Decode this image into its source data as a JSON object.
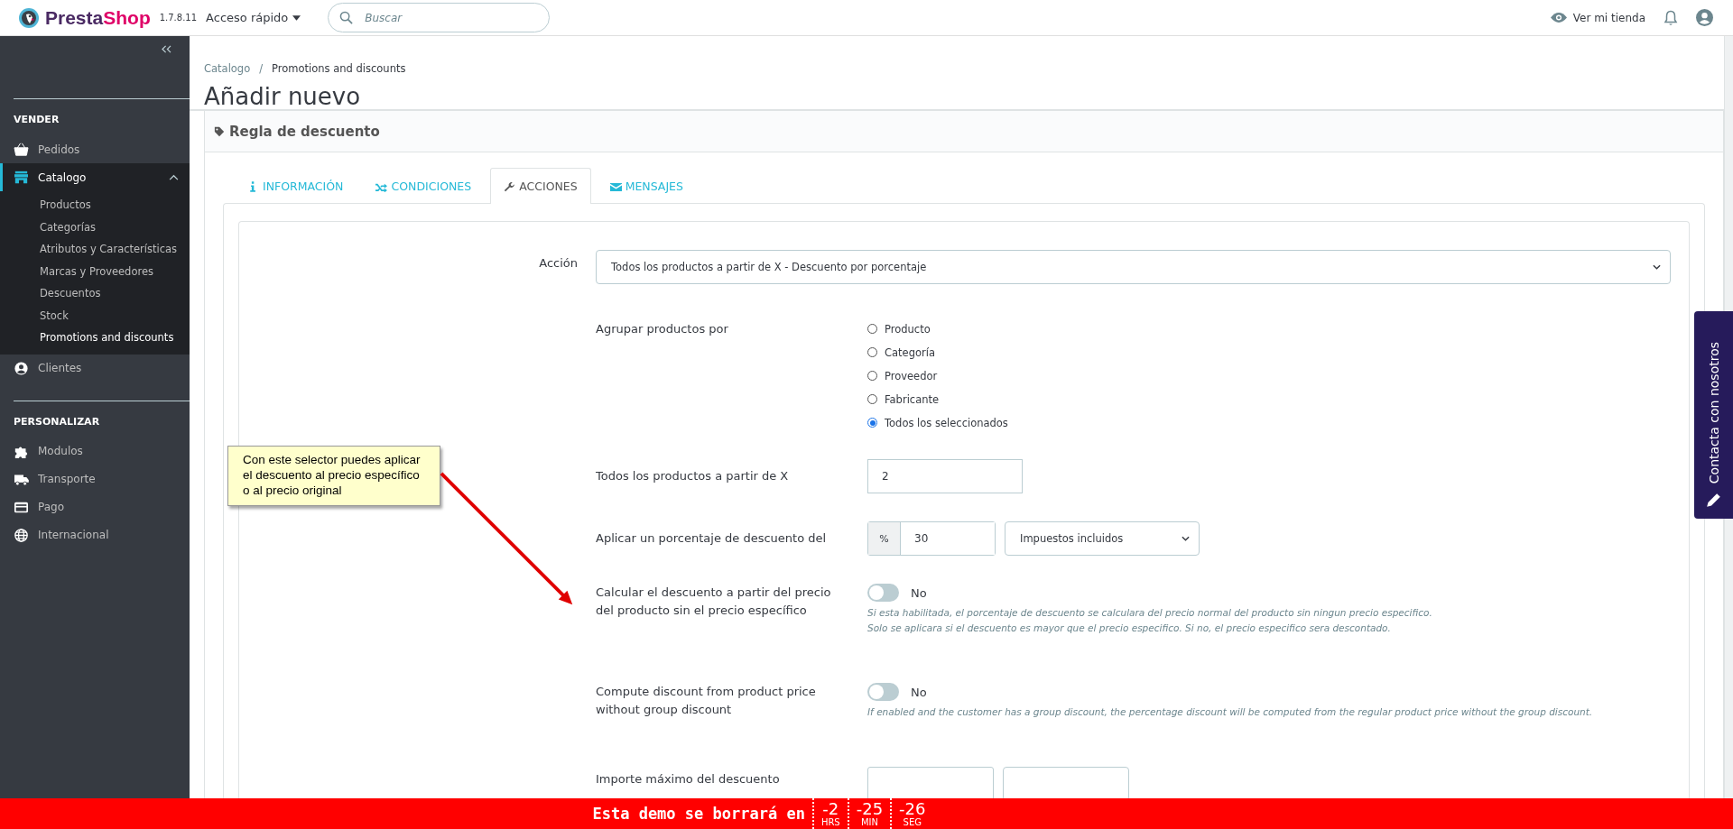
{
  "header": {
    "logo_name": [
      "Presta",
      "Shop"
    ],
    "version": "1.7.8.11",
    "quick_access": "Acceso rápido",
    "search": {
      "placeholder": "Buscar"
    },
    "view_store": "Ver mi tienda"
  },
  "sidebar": {
    "sections": [
      {
        "title": "VENDER",
        "items": [
          {
            "label": "Pedidos",
            "selected": false
          },
          {
            "label": "Catalogo",
            "selected": true,
            "expanded": true,
            "children": [
              {
                "label": "Productos",
                "selected": false
              },
              {
                "label": "Categorías",
                "selected": false
              },
              {
                "label": "Atributos y Características",
                "selected": false
              },
              {
                "label": "Marcas y Proveedores",
                "selected": false
              },
              {
                "label": "Descuentos",
                "selected": false
              },
              {
                "label": "Stock",
                "selected": false
              },
              {
                "label": "Promotions and discounts",
                "selected": true
              }
            ]
          },
          {
            "label": "Clientes",
            "selected": false
          }
        ]
      },
      {
        "title": "PERSONALIZAR",
        "items": [
          {
            "label": "Modulos",
            "selected": false
          },
          {
            "label": "Transporte",
            "selected": false
          },
          {
            "label": "Pago",
            "selected": false
          },
          {
            "label": "Internacional",
            "selected": false
          }
        ]
      }
    ]
  },
  "breadcrumb": {
    "items": [
      "Catalogo",
      "Promotions and discounts"
    ],
    "separator": "/"
  },
  "page_title": "Añadir nuevo",
  "panel_title": "Regla de descuento",
  "tabs": [
    {
      "label": "INFORMACIÓN",
      "selected": false
    },
    {
      "label": "CONDICIONES",
      "selected": false
    },
    {
      "label": "ACCIONES",
      "selected": true
    },
    {
      "label": "MENSAJES",
      "selected": false
    }
  ],
  "form": {
    "action": {
      "label": "Acción",
      "value": "Todos los productos a partir de X - Descuento por porcentaje"
    },
    "group_by": {
      "label": "Agrupar productos por",
      "options": [
        {
          "label": "Producto",
          "selected": false
        },
        {
          "label": "Categoría",
          "selected": false
        },
        {
          "label": "Proveedor",
          "selected": false
        },
        {
          "label": "Fabricante",
          "selected": false
        },
        {
          "label": "Todos los seleccionados",
          "selected": true
        }
      ]
    },
    "min_quantity": {
      "label": "Todos los productos a partir de X",
      "value": "2"
    },
    "percent": {
      "label": "Aplicar un porcentaje de descuento del",
      "addon": "%",
      "value": "30",
      "tax": "Impuestos incluidos"
    },
    "toggles": [
      {
        "label": "Calcular el descuento a partir del precio del producto sin el precio específico",
        "on": false,
        "state_text": "No",
        "help": [
          "Si esta habilitada, el porcentaje de descuento se calculara del precio normal del producto sin ningun precio especifico.",
          "Solo se aplicara si el descuento es mayor que el precio especifico. Si no, el precio especifico sera descontado."
        ]
      },
      {
        "label": "Compute discount from product price without group discount",
        "on": false,
        "state_text": "No",
        "help": [
          "If enabled and the customer has a group discount, the percentage discount will be computed from the regular product price without the group discount."
        ]
      }
    ],
    "max_amount": {
      "label": "Importe máximo del descuento"
    }
  },
  "callout": "Con este selector puedes aplicar\nel descuento al precio específico\no al precio original",
  "contact_tab": "Contacta con nosotros",
  "countdown": {
    "text": "Esta demo se borrará en",
    "units": [
      {
        "value": "-2",
        "label": "HRS"
      },
      {
        "value": "-25",
        "label": "MIN"
      },
      {
        "value": "-26",
        "label": "SEG"
      }
    ]
  }
}
